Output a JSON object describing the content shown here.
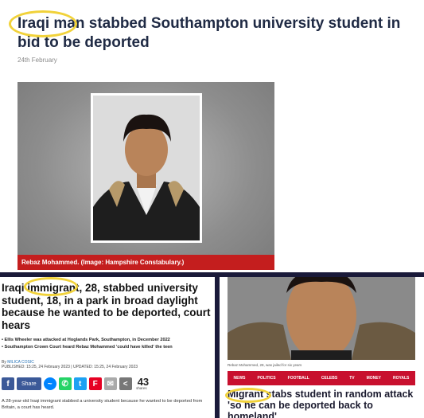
{
  "top": {
    "headline": "Iraqi man stabbed Southampton university student in bid to be deported",
    "date": "24th February",
    "caption": "Rebaz Mohammed. (Image: Hampshire Constabulary.)"
  },
  "bottom_left": {
    "headline": "Iraqi immigrant, 28, stabbed university student, 18, in a park in broad daylight because he wanted to be deported, court hears",
    "bullets": [
      "Ellis Wheeler was attacked at Hoglands Park, Southampton, in December 2022",
      "Southampton Crown Court heard Rebaz Mohammed 'could have killed' the teen"
    ],
    "by_label": "By",
    "author": "MILICA COSIC",
    "published": "PUBLISHED: 15:25, 24 February 2023 | UPDATED: 15:25, 24 February 2023",
    "share_label": "Share",
    "share_count": "43",
    "shares_label": "shares",
    "body": "A 28-year-old Iraqi immigrant stabbed a university student because he wanted to be deported from Britain, a court has heard."
  },
  "bottom_right": {
    "caption": "Rebaz Mohammed, 28, was jailed for six years",
    "nav": [
      "NEWS",
      "POLITICS",
      "FOOTBALL",
      "CELEBS",
      "TV",
      "MONEY",
      "ROYALS"
    ],
    "headline": "Migrant stabs student in random attack 'so he can be deported back to homeland'"
  },
  "colors": {
    "highlight_circle": "#f1d23a",
    "caption_red": "#c41e1e",
    "nav_red": "#c8102e",
    "facebook": "#3b5998"
  }
}
